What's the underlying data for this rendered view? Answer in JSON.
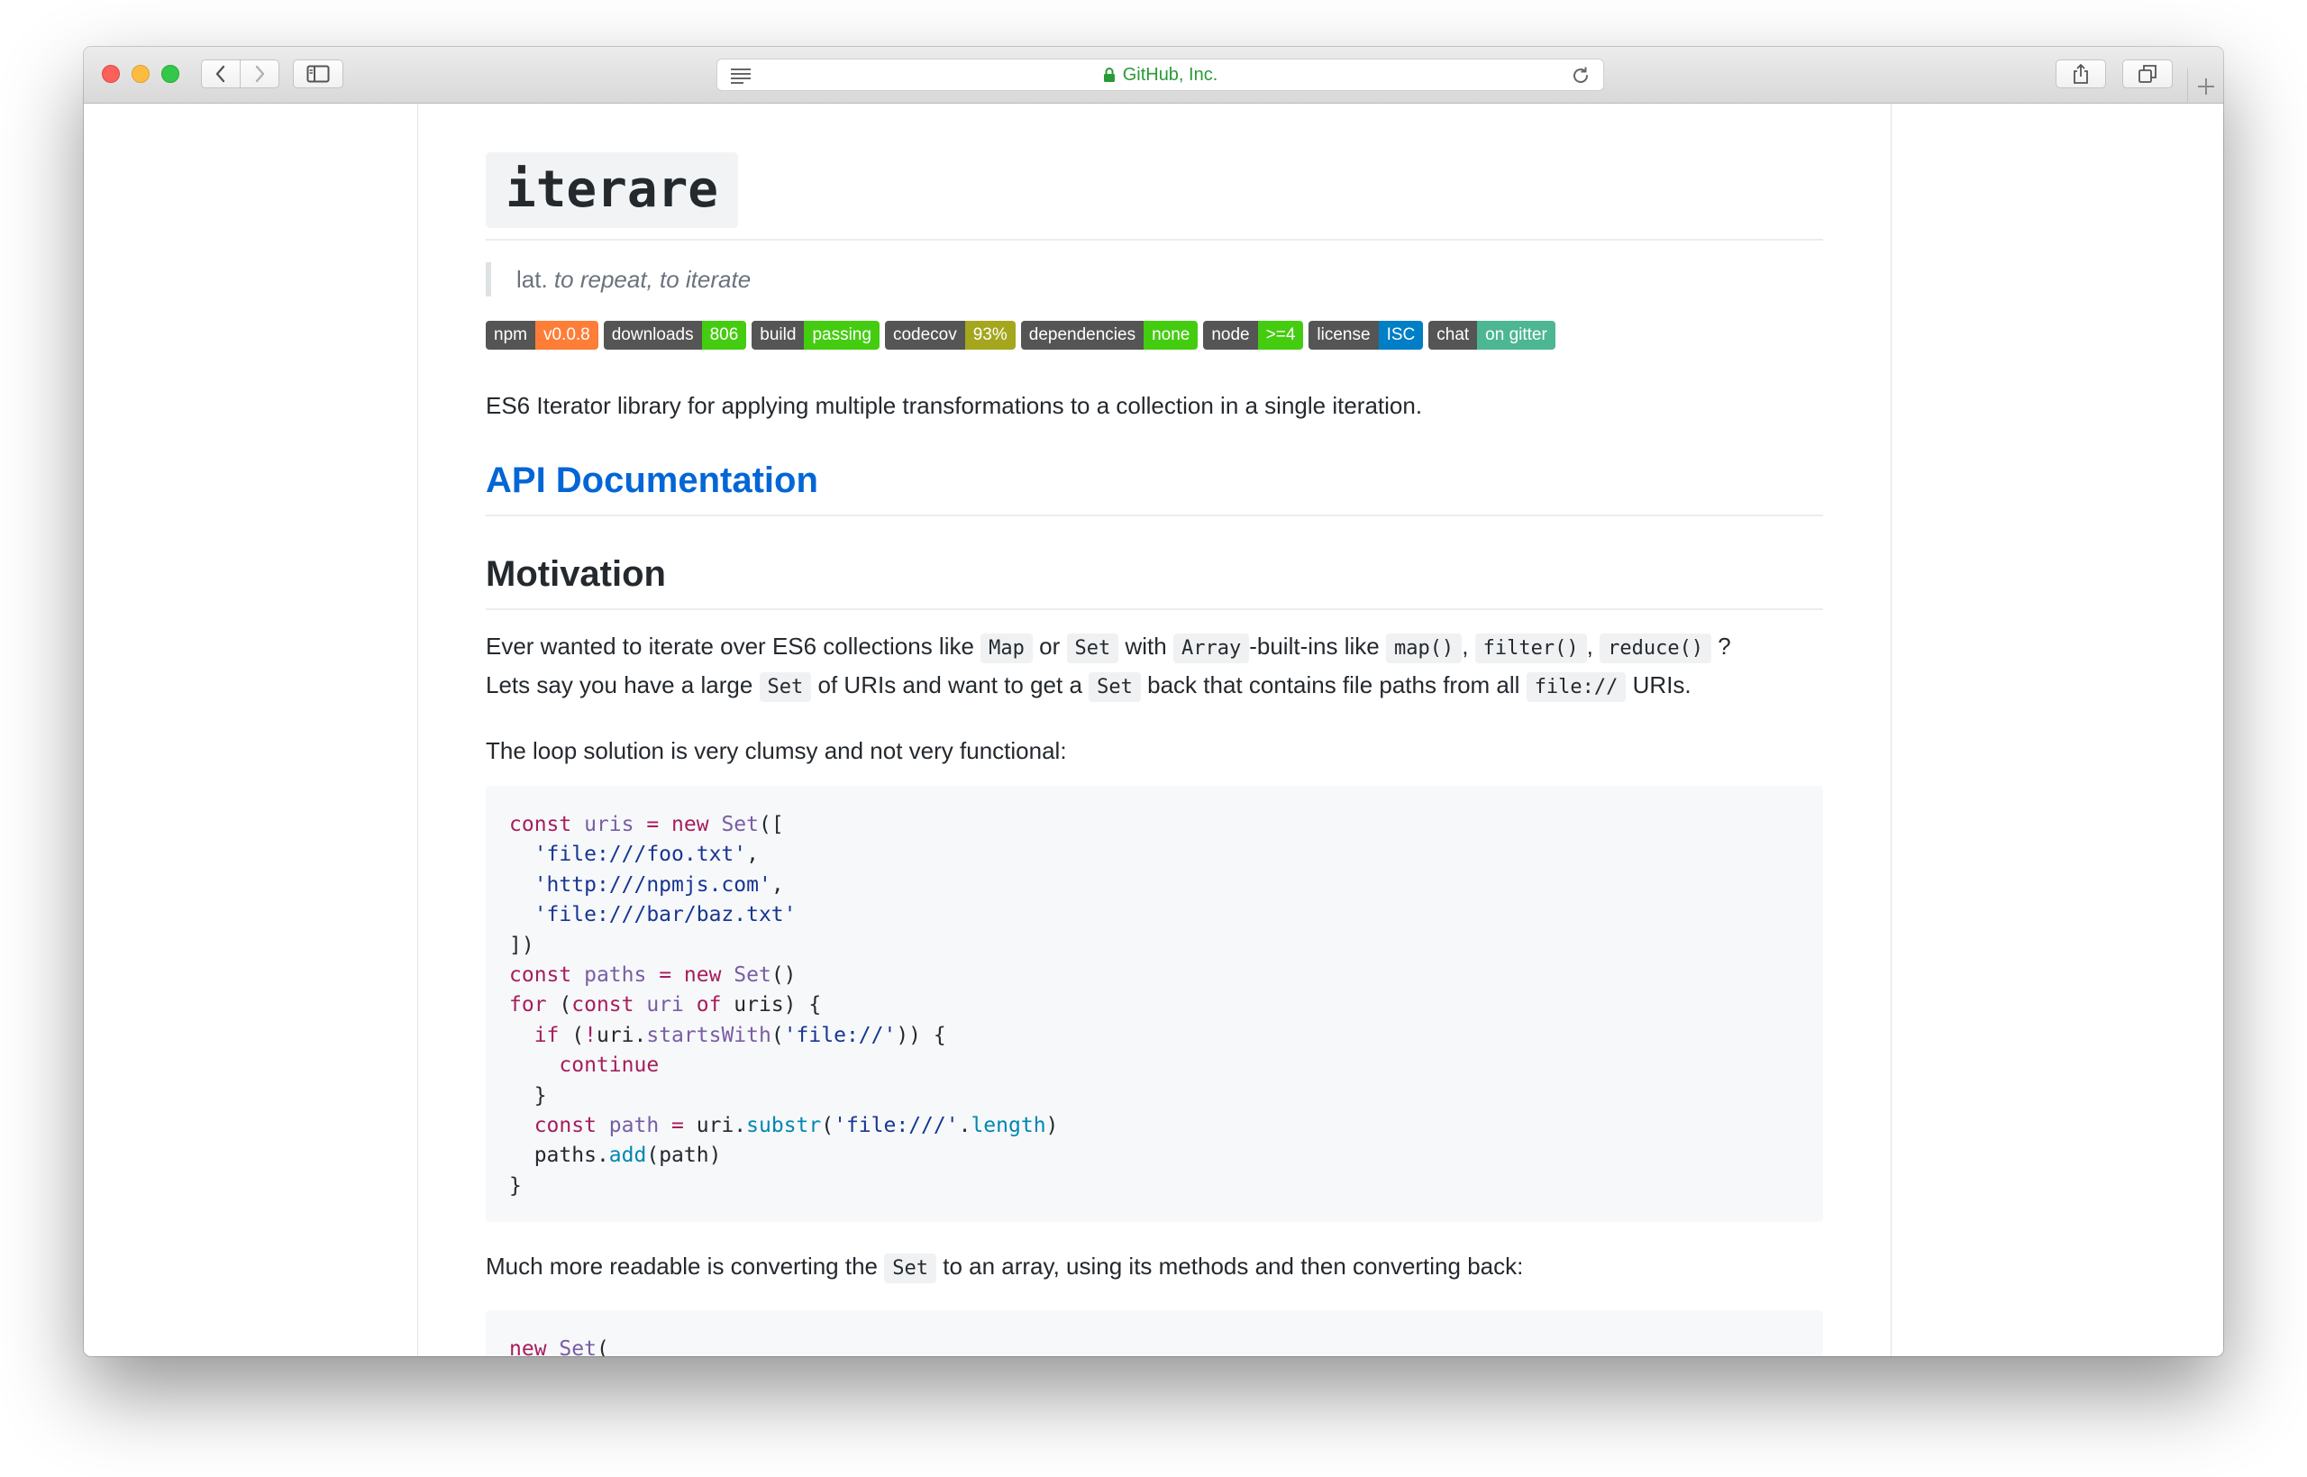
{
  "browser": {
    "address_text": "GitHub, Inc.",
    "address_color": "#2a9a37",
    "icons": [
      "close-light",
      "minimize-light",
      "zoom-light",
      "back-chevron-icon",
      "forward-chevron-icon",
      "sidebar-icon",
      "reader-icon",
      "lock-icon",
      "reload-icon",
      "share-icon",
      "tabs-icon",
      "plus-icon"
    ]
  },
  "readme": {
    "title": "iterare",
    "tagline_prefix": "lat.",
    "tagline_em": "to repeat, to iterate",
    "badges": [
      {
        "label": "npm",
        "value": "v0.0.8",
        "color": "#fe7d37"
      },
      {
        "label": "downloads",
        "value": "806",
        "color": "#4c1"
      },
      {
        "label": "build",
        "value": "passing",
        "color": "#4c1"
      },
      {
        "label": "codecov",
        "value": "93%",
        "color": "#a4a61d"
      },
      {
        "label": "dependencies",
        "value": "none",
        "color": "#4c1"
      },
      {
        "label": "node",
        "value": ">=4",
        "color": "#4c1"
      },
      {
        "label": "license",
        "value": "ISC",
        "color": "#007ec6"
      },
      {
        "label": "chat",
        "value": "on gitter",
        "color": "#4db692"
      }
    ],
    "intro": "ES6 Iterator library for applying multiple transformations to a collection in a single iteration.",
    "api_heading": "API Documentation",
    "api_color": "#0366d6",
    "motivation_heading": "Motivation",
    "motivation": {
      "t1": "Ever wanted to iterate over ES6 collections like",
      "c1": "Map",
      "t2": "or",
      "c2": "Set",
      "t3": "with",
      "c3": "Array",
      "t4": "-built-ins like",
      "c4": "map()",
      "t5": ",",
      "c5": "filter()",
      "t6": ",",
      "c6": "reduce()",
      "t7": "?",
      "t8": "Lets say you have a large",
      "c7": "Set",
      "t9": "of URIs and want to get a",
      "c8": "Set",
      "t10": "back that contains file paths from all",
      "c9": "file://",
      "t11": "URIs."
    },
    "loop_text": "The loop solution is very clumsy and not very functional:",
    "code": {
      "l1": {
        "a": "const",
        "b": " uris ",
        "c": "=",
        "d": " new",
        "e": " Set",
        "f": "(["
      },
      "l2": "'file:///foo.txt'",
      "l3": "'http:///npmjs.com'",
      "l4": "'file:///bar/baz.txt'",
      "l5": "])",
      "l6": {
        "a": "const",
        "b": " paths ",
        "c": "=",
        "d": " new",
        "e": " Set",
        "f": "()"
      },
      "l7": {
        "a": "for",
        "b": " (",
        "c": "const",
        "d": " uri",
        "e": " of",
        "f": " uris) {"
      },
      "l8": {
        "a": "if",
        "b": " (",
        "c": "!",
        "d": "uri.",
        "e": "startsWith",
        "f": "(",
        "g": "'file://'",
        "h": ")) {"
      },
      "l9": "continue",
      "l10": "}",
      "l11": {
        "a": "const",
        "b": " path",
        "c": " =",
        "d": " uri.",
        "e": "substr",
        "f": "(",
        "g": "'file:///'",
        "h": ".",
        "i": "length",
        "j": ")"
      },
      "l12": {
        "a": "paths.",
        "b": "add",
        "c": "(path)"
      },
      "l13": "}"
    },
    "readable": {
      "t1": "Much more readable is converting the",
      "c1": "Set",
      "t2": "to an array, using its methods and then converting back:"
    },
    "code2": {
      "a": "new",
      "b": " Set",
      "c": "("
    }
  }
}
